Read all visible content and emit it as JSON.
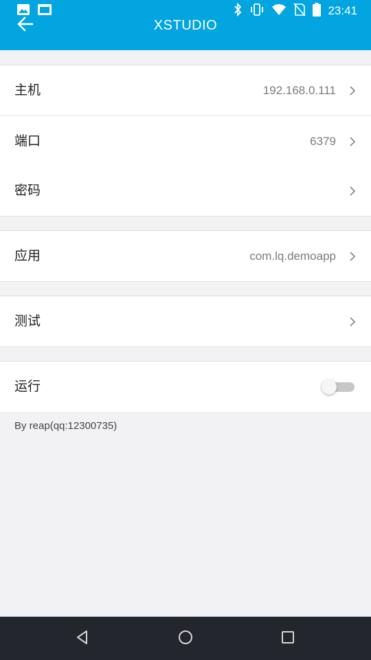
{
  "status_bar": {
    "time": "23:41",
    "icons_left": [
      "image-icon",
      "screen-icon"
    ],
    "icons_right": [
      "bluetooth-icon",
      "vibrate-icon",
      "wifi-icon",
      "no-sim-icon",
      "battery-icon"
    ]
  },
  "app_bar": {
    "title": "XSTUDIO",
    "back_icon": "arrow-left-icon"
  },
  "settings": {
    "host": {
      "label": "主机",
      "value": "192.168.0.111"
    },
    "port": {
      "label": "端口",
      "value": "6379"
    },
    "password": {
      "label": "密码",
      "value": ""
    },
    "app": {
      "label": "应用",
      "value": "com.lq.demoapp"
    },
    "test": {
      "label": "测试"
    },
    "run": {
      "label": "运行",
      "enabled": false
    }
  },
  "footer": {
    "note": "By reap(qq:12300735)"
  },
  "nav_bar": {
    "buttons": [
      "back-triangle-icon",
      "home-circle-icon",
      "recents-square-icon"
    ]
  },
  "colors": {
    "primary": "#02a5e0",
    "background": "#f2f2f4",
    "nav_bar": "#24262d"
  }
}
